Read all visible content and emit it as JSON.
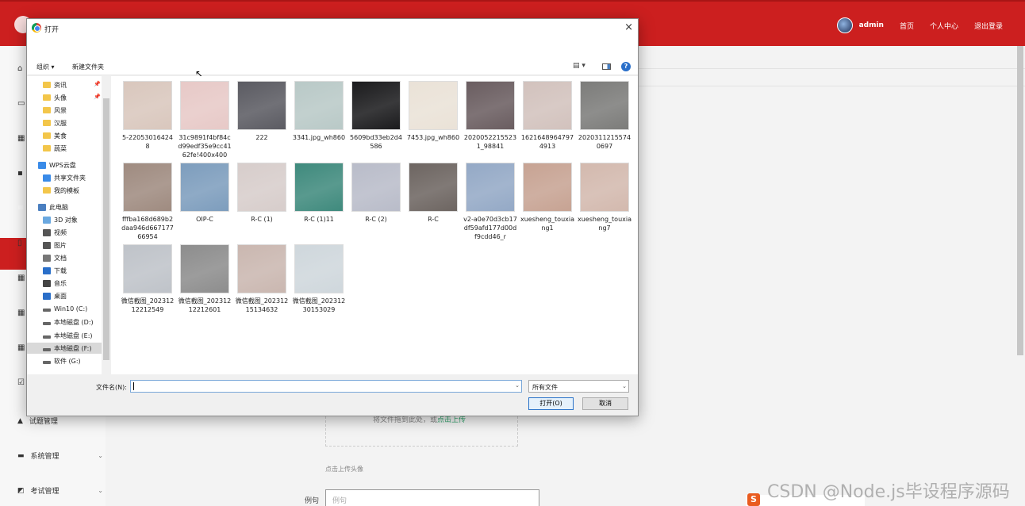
{
  "app": {
    "header": {
      "user": "admin",
      "links": [
        "首页",
        "个人中心",
        "退出登录"
      ]
    },
    "sidebar": {
      "items": [
        {
          "label": "试题管理"
        },
        {
          "label": "系统管理"
        },
        {
          "label": "考试管理"
        }
      ]
    },
    "upload": {
      "drop_text": "将文件拖到此处，或",
      "click_text": "点击上传",
      "hint": "点击上传头像"
    },
    "example": {
      "label": "例句",
      "placeholder": "例句"
    },
    "watermark": "CSDN @Node.js毕设程序源码",
    "tray_icon": "S",
    "colors": {
      "accent": "#cc1f1f",
      "link": "#2fa36b"
    }
  },
  "dialog": {
    "title": "打开",
    "close_glyph": "×",
    "toolbar": {
      "organize": "组织 ▾",
      "new_folder": "新建文件夹",
      "help": "?"
    },
    "nav": [
      {
        "label": "资讯",
        "icon": "folder-icon",
        "pinned": true
      },
      {
        "label": "头像",
        "icon": "folder-icon",
        "pinned": true
      },
      {
        "label": "风景",
        "icon": "folder-icon"
      },
      {
        "label": "汉服",
        "icon": "folder-icon"
      },
      {
        "label": "美食",
        "icon": "folder-icon"
      },
      {
        "label": "蔬菜",
        "icon": "folder-icon"
      },
      {
        "label": "WPS云盘",
        "icon": "cloud-icon"
      },
      {
        "label": "共享文件夹",
        "icon": "share-icon"
      },
      {
        "label": "我的模板",
        "icon": "folder-icon"
      },
      {
        "label": "此电脑",
        "icon": "pc-icon"
      },
      {
        "label": "3D 对象",
        "icon": "3d-icon"
      },
      {
        "label": "视频",
        "icon": "video-icon"
      },
      {
        "label": "图片",
        "icon": "picture-icon"
      },
      {
        "label": "文档",
        "icon": "document-icon"
      },
      {
        "label": "下载",
        "icon": "download-icon"
      },
      {
        "label": "音乐",
        "icon": "music-icon"
      },
      {
        "label": "桌面",
        "icon": "desktop-icon"
      },
      {
        "label": "Win10 (C:)",
        "icon": "drive-icon"
      },
      {
        "label": "本地磁盘 (D:)",
        "icon": "drive-icon"
      },
      {
        "label": "本地磁盘 (E:)",
        "icon": "drive-icon"
      },
      {
        "label": "本地磁盘 (F:)",
        "icon": "drive-icon",
        "selected": true
      },
      {
        "label": "软件 (G:)",
        "icon": "drive-icon"
      }
    ],
    "files": [
      {
        "name": "5-220530164248",
        "color": "#d9c7bd"
      },
      {
        "name": "31c9891f4bf84cd99edf35e9cc4162fe!400x400",
        "color": "#e7c9c7"
      },
      {
        "name": "222",
        "color": "#5b5b62"
      },
      {
        "name": "3341.jpg_wh860",
        "color": "#b9c9c7"
      },
      {
        "name": "5609bd33eb2d4586",
        "color": "#1b1b1d"
      },
      {
        "name": "7453.jpg_wh860",
        "color": "#eae2d7"
      },
      {
        "name": "20200522155231_98841",
        "color": "#6a5d60"
      },
      {
        "name": "1621648964797 4913",
        "color": "#d2c2bd"
      },
      {
        "name": "20203112155740697",
        "color": "#7c7c7a"
      },
      {
        "name": "fffba168d689b2daa946d66717766954",
        "color": "#9f8b80"
      },
      {
        "name": "OIP-C",
        "color": "#7d9dbd"
      },
      {
        "name": "R-C (1)",
        "color": "#d7cdcb"
      },
      {
        "name": "R-C (1)11",
        "color": "#3f8a7d"
      },
      {
        "name": "R-C (2)",
        "color": "#b9bcc9"
      },
      {
        "name": "R-C",
        "color": "#6d6561"
      },
      {
        "name": "v2-a0e70d3cb17df59afd177d00df9cdd46_r",
        "color": "#94a9c6"
      },
      {
        "name": "xuesheng_touxiang1",
        "color": "#c7a393"
      },
      {
        "name": "xuesheng_touxiang7",
        "color": "#d3b9ae"
      },
      {
        "name": "微信截图_20231212212549",
        "color": "#bfc3c9"
      },
      {
        "name": "微信截图_20231212212601",
        "color": "#8d8d8d"
      },
      {
        "name": "微信截图_20231215134632",
        "color": "#cab7b0"
      },
      {
        "name": "微信截图_20231230153029",
        "color": "#cfd7dc"
      }
    ],
    "footer": {
      "filename_label": "文件名(N):",
      "filename_value": "",
      "filter": "所有文件",
      "open": "打开(O)",
      "cancel": "取消"
    }
  }
}
